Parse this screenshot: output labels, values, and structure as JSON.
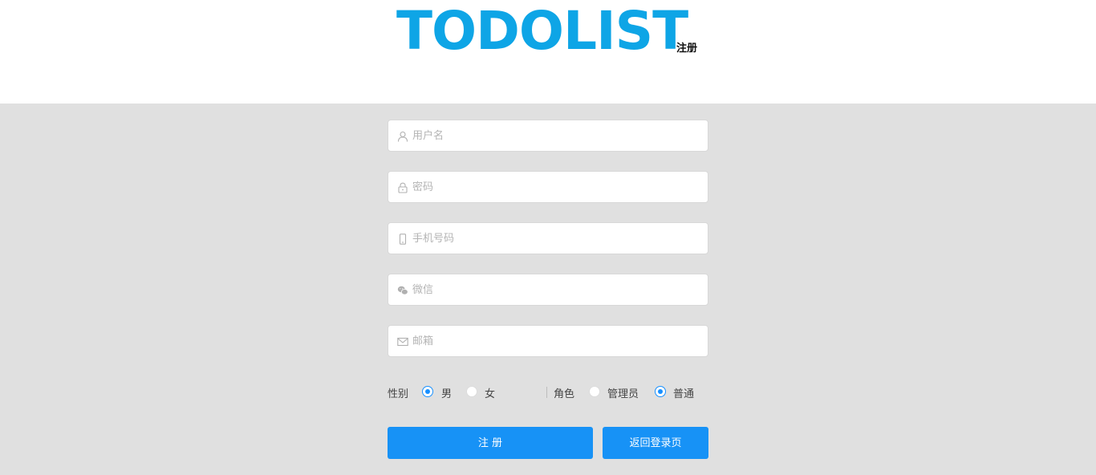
{
  "header": {
    "logo": "TODOLIST",
    "subtitle": "注册"
  },
  "form": {
    "username": {
      "placeholder": "用户名",
      "icon": "user-icon"
    },
    "password": {
      "placeholder": "密码",
      "icon": "lock-icon"
    },
    "phone": {
      "placeholder": "手机号码",
      "icon": "phone-icon"
    },
    "wechat": {
      "placeholder": "微信",
      "icon": "wechat-icon"
    },
    "email": {
      "placeholder": "邮箱",
      "icon": "mail-icon"
    },
    "gender": {
      "label": "性别",
      "options": [
        "男",
        "女"
      ],
      "selected": "男"
    },
    "role": {
      "label": "角色",
      "options": [
        "管理员",
        "普通"
      ],
      "selected": "普通"
    },
    "register_label": "注 册",
    "back_label": "返回登录页"
  },
  "colors": {
    "brand": "#0ea5e6",
    "button": "#1792f6",
    "background": "#e0e0e0"
  }
}
